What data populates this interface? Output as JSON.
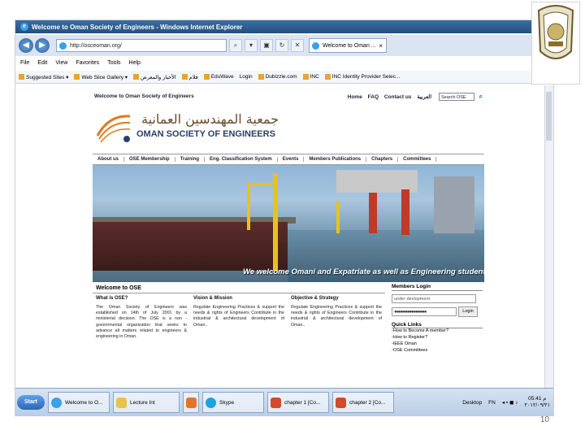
{
  "slide": {
    "number": "10"
  },
  "browser": {
    "title": "Welcome to Oman Society of Engineers - Windows Internet Explorer",
    "url": "http://osceoman.org/",
    "tab_title": "Welcome to Oman ...",
    "menu": [
      "File",
      "Edit",
      "View",
      "Favorites",
      "Tools",
      "Help"
    ],
    "favorites": [
      "Suggested Sites ▾",
      "Web Slice Gallery ▾",
      "الأخبار والمعرض",
      "فلام",
      "EduWave",
      "Login",
      "Dubizzle.com",
      "INC",
      "INC Identity Provider Selec..."
    ]
  },
  "site": {
    "top_welcome": "Welcome to Oman Society of Engineers",
    "top_links": [
      "Home",
      "FAQ",
      "Contact us",
      "العربية"
    ],
    "search_placeholder": "Search OSE",
    "logo_arabic": "جمعية المهندسين العمانية",
    "logo_english": "OMAN SOCIETY OF ENGINEERS",
    "nav": [
      "About us",
      "OSE Membership",
      "Training",
      "Eng. Classification System",
      "Events",
      "Members Publications",
      "Chapters",
      "Committees"
    ],
    "hero_caption": "We welcome Omani and Expatriate as well as Engineering students",
    "welcome_heading": "Welcome to OSE",
    "columns": [
      {
        "heading": "What is OSE?",
        "body": "The Oman Society of Engineers was established on 14th of July 2001 by a ministerial decision. The OSE is a non -governmental organization that seeks to advance all matters related to engineers & engineering in Oman."
      },
      {
        "heading": "Vision & Mission",
        "body": "Regulate Engineering Practices & support the needs & rights of Engineers Contribute in the industrial & architectural development of Oman.."
      },
      {
        "heading": "Objective & Strategy",
        "body": "Regulate Engineering Practices & support the needs & rights of Engineers Contribute in the industrial & architectural development of Oman.."
      }
    ],
    "members_login": {
      "heading": "Members Login",
      "username_value": "under devlopment",
      "password_value": "●●●●●●●●●●●●●●●",
      "login_label": "Login"
    },
    "quick_links": {
      "heading": "Quick Links",
      "items": [
        "-How to Become A member?",
        "-How to Register?",
        "-IEEE Oman",
        "-OSE Committees"
      ]
    }
  },
  "taskbar": {
    "start_label": "Start",
    "buttons": [
      "Welcome to O...",
      "Lecture Int",
      "Skype",
      "chapter 1 [Co...",
      "chapter 2 [Co..."
    ],
    "desktop_label": "Desktop",
    "lang": "FN",
    "time": "05:41 م",
    "date": "٢٠١٢/٠٩/٢١"
  },
  "colors": {
    "titlebar": "#2e5f95",
    "taskbar": "#c6d6ea",
    "site_nav_text": "#223344"
  }
}
